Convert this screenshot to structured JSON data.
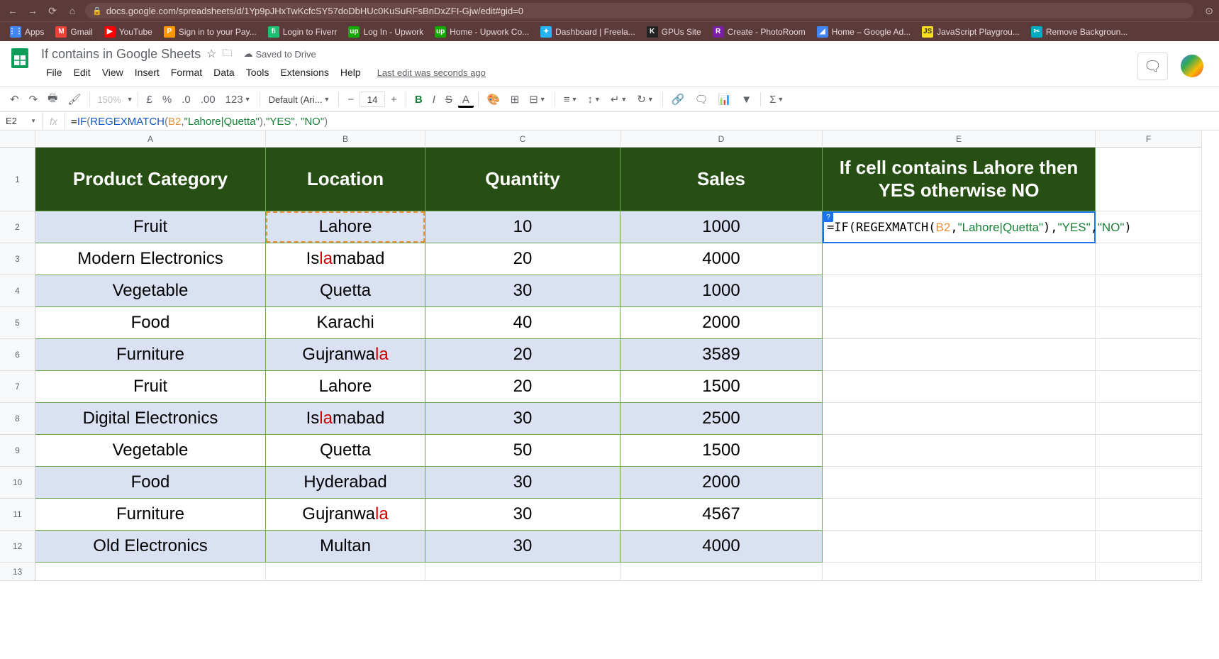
{
  "browser": {
    "url": "docs.google.com/spreadsheets/d/1Yp9pJHxTwKcfcSY57doDbHUc0KuSuRFsBnDxZFI-Gjw/edit#gid=0",
    "bookmarks": [
      {
        "label": "Apps",
        "cls": "bm-apps",
        "icon": "⋮⋮"
      },
      {
        "label": "Gmail",
        "cls": "bm-gmail",
        "icon": "M"
      },
      {
        "label": "YouTube",
        "cls": "bm-yt",
        "icon": "▶"
      },
      {
        "label": "Sign in to your Pay...",
        "cls": "bm-pay",
        "icon": "P"
      },
      {
        "label": "Login to Fiverr",
        "cls": "bm-fiverr",
        "icon": "fi"
      },
      {
        "label": "Log In - Upwork",
        "cls": "bm-upwork",
        "icon": "up"
      },
      {
        "label": "Home - Upwork Co...",
        "cls": "bm-upwork",
        "icon": "up"
      },
      {
        "label": "Dashboard | Freela...",
        "cls": "bm-dash",
        "icon": "✦"
      },
      {
        "label": "GPUs Site",
        "cls": "bm-gpu",
        "icon": "K"
      },
      {
        "label": "Create - PhotoRoom",
        "cls": "bm-photo",
        "icon": "R"
      },
      {
        "label": "Home – Google Ad...",
        "cls": "bm-gads",
        "icon": "◢"
      },
      {
        "label": "JavaScript Playgrou...",
        "cls": "bm-js",
        "icon": "JS"
      },
      {
        "label": "Remove Backgroun...",
        "cls": "bm-bg",
        "icon": "✂"
      }
    ]
  },
  "doc": {
    "title": "If contains in Google Sheets",
    "saved": "Saved to Drive",
    "last_edit": "Last edit was seconds ago",
    "menus": [
      "File",
      "Edit",
      "View",
      "Insert",
      "Format",
      "Data",
      "Tools",
      "Extensions",
      "Help"
    ]
  },
  "toolbar": {
    "zoom": "150%",
    "font": "Default (Ari...",
    "font_size": "14"
  },
  "formula_bar": {
    "name_box": "E2",
    "formula_raw": "=IF(REGEXMATCH(B2,\"Lahore|Quetta\"),\"YES\", \"NO\")"
  },
  "columns": [
    "A",
    "B",
    "C",
    "D",
    "E",
    "F"
  ],
  "headers": {
    "A": "Product Category",
    "B": "Location",
    "C": "Quantity",
    "D": "Sales",
    "E": "If cell contains Lahore then YES otherwise NO"
  },
  "rows": [
    {
      "n": 2,
      "A": "Fruit",
      "B": "Lahore",
      "C": "10",
      "D": "1000"
    },
    {
      "n": 3,
      "A": "Modern Electronics",
      "B": "Islamabad",
      "C": "20",
      "D": "4000"
    },
    {
      "n": 4,
      "A": "Vegetable",
      "B": "Quetta",
      "C": "30",
      "D": "1000"
    },
    {
      "n": 5,
      "A": "Food",
      "B": "Karachi",
      "C": "40",
      "D": "2000"
    },
    {
      "n": 6,
      "A": "Furniture",
      "B": "Gujranwala",
      "C": "20",
      "D": "3589"
    },
    {
      "n": 7,
      "A": "Fruit",
      "B": "Lahore",
      "C": "20",
      "D": "1500"
    },
    {
      "n": 8,
      "A": "Digital Electronics",
      "B": "Islamabad",
      "C": "30",
      "D": "2500"
    },
    {
      "n": 9,
      "A": "Vegetable",
      "B": "Quetta",
      "C": "50",
      "D": "1500"
    },
    {
      "n": 10,
      "A": "Food",
      "B": "Hyderabad",
      "C": "30",
      "D": "2000"
    },
    {
      "n": 11,
      "A": "Furniture",
      "B": "Gujranwala",
      "C": "30",
      "D": "4567"
    },
    {
      "n": 12,
      "A": "Old Electronics",
      "B": "Multan",
      "C": "30",
      "D": "4000"
    }
  ],
  "e2_display": "=IF(REGEXMATCH(B2,\"Lahore|Quetta\"),\"YES\", \"NO\")"
}
